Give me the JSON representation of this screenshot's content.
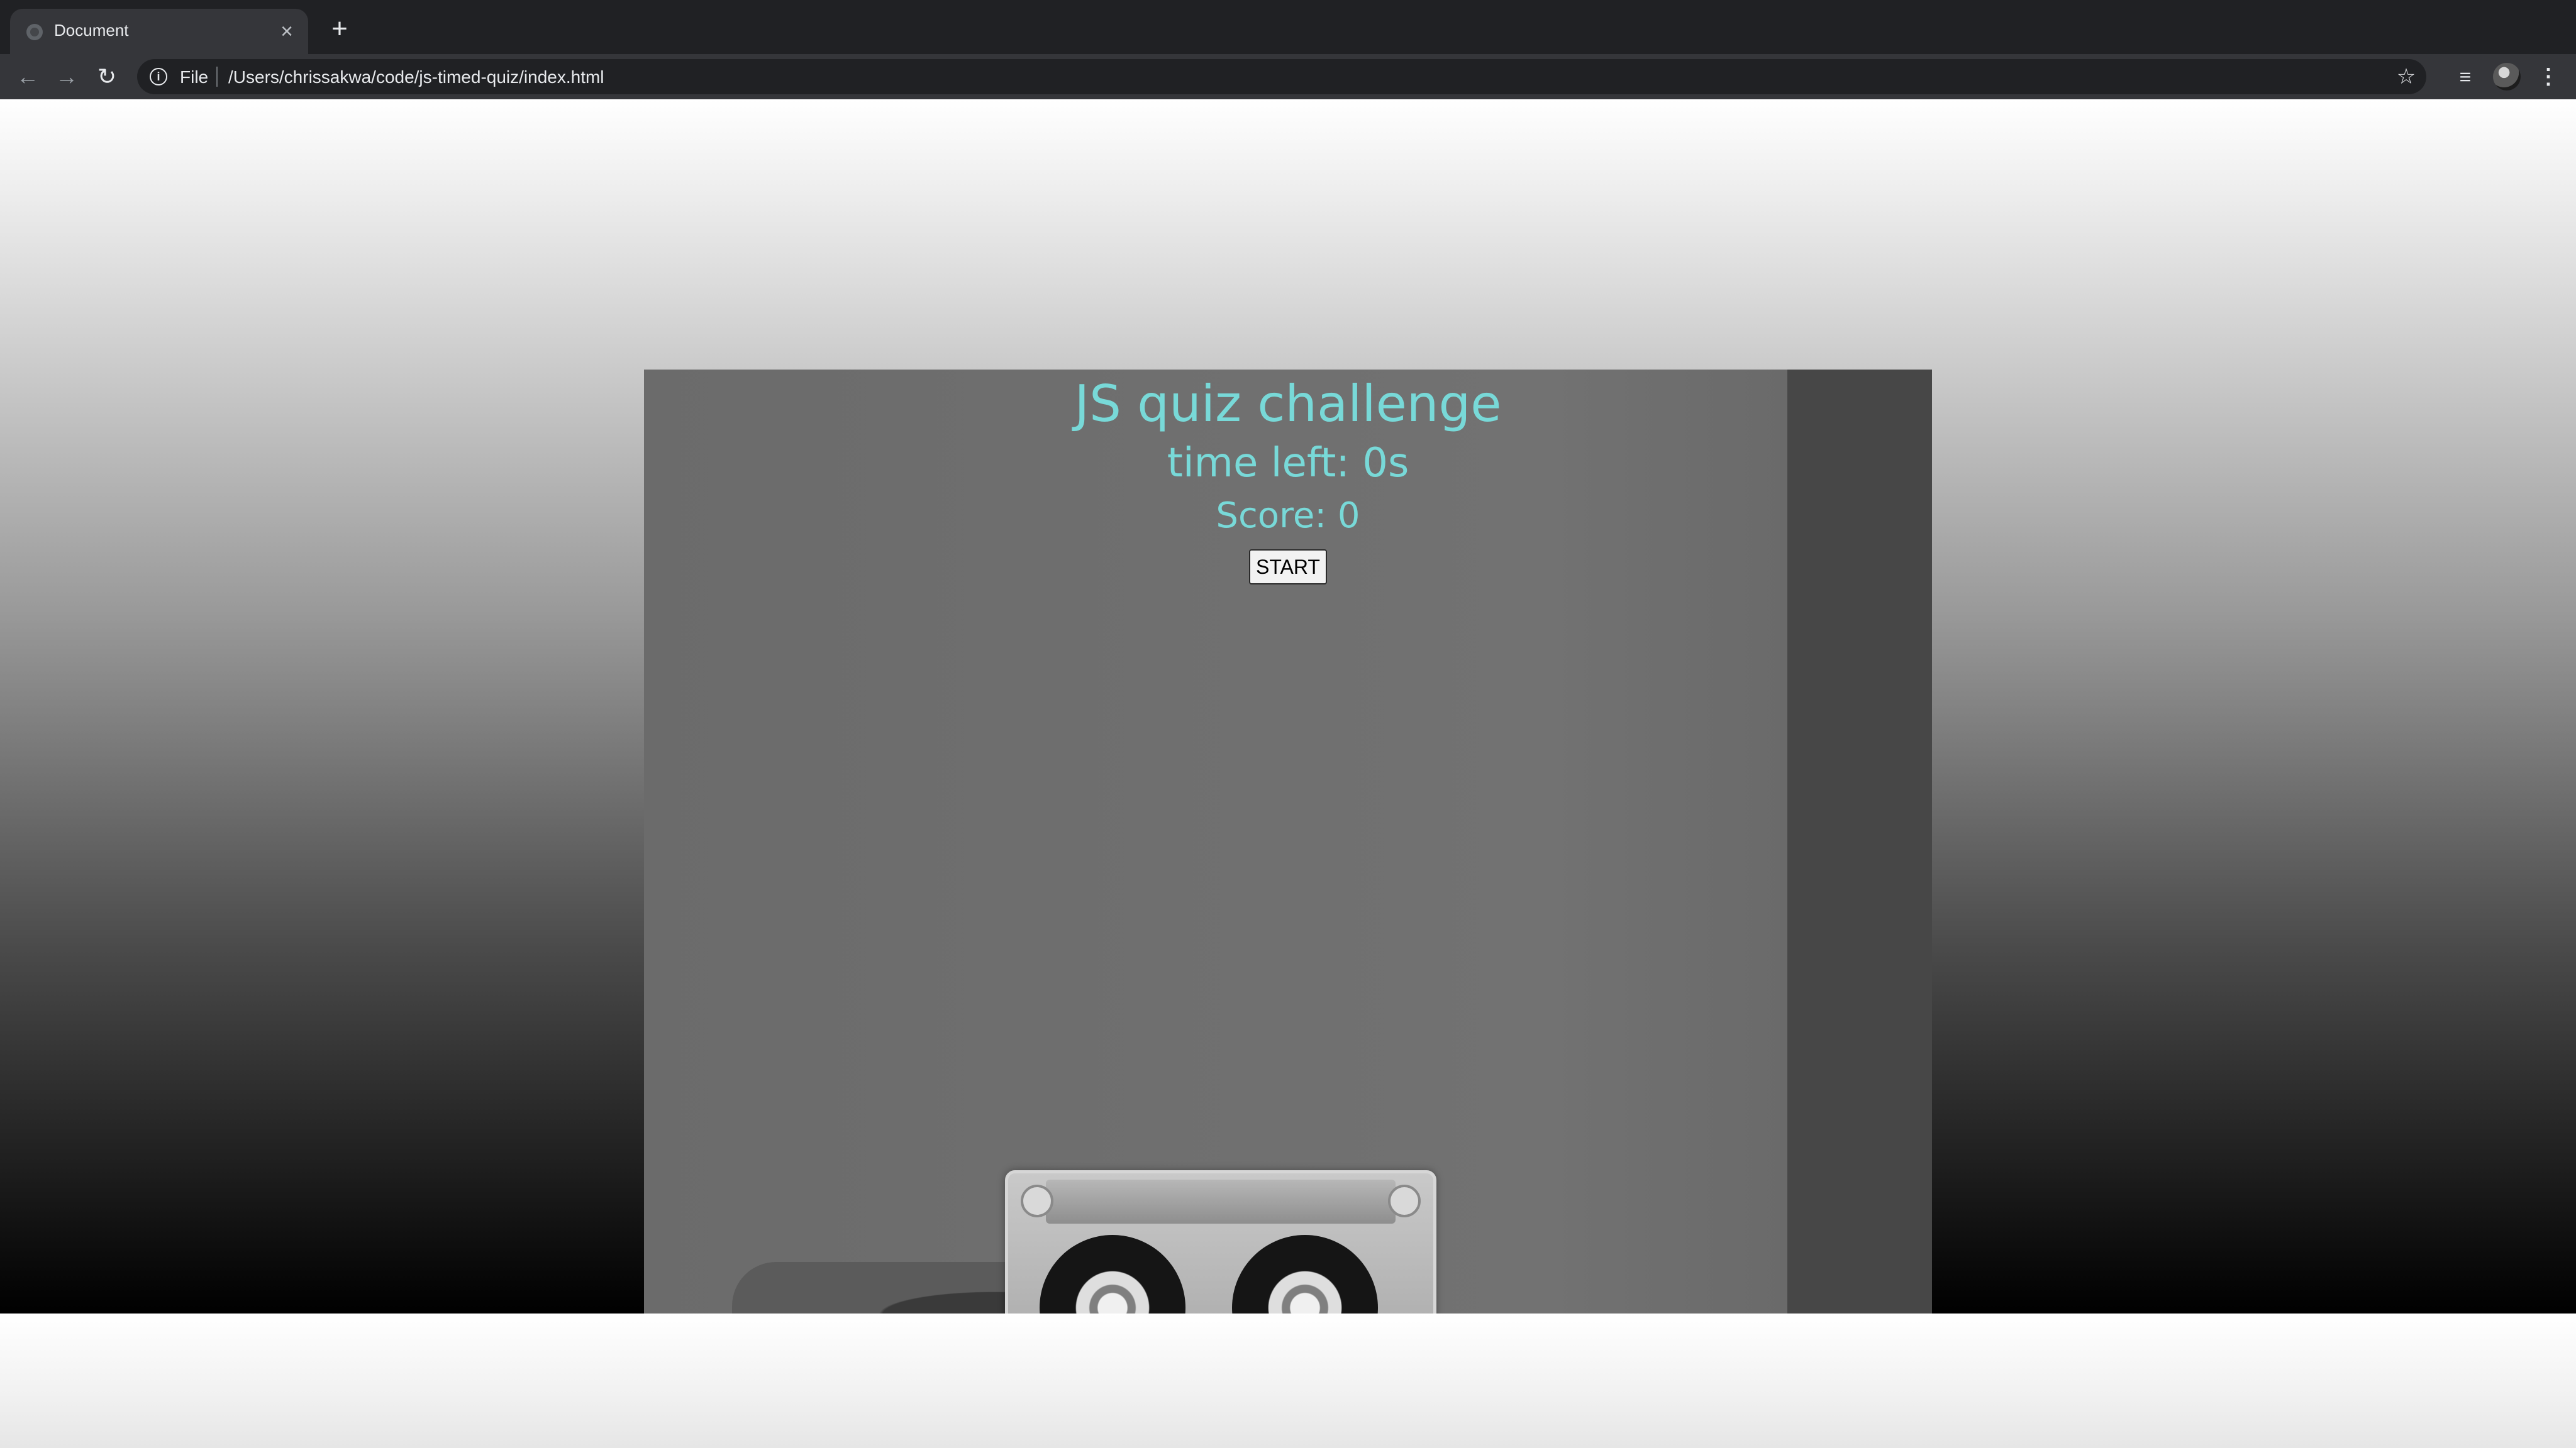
{
  "browser": {
    "tab": {
      "title": "Document",
      "close_icon": "×"
    },
    "new_tab_icon": "+",
    "toolbar": {
      "back_icon": "←",
      "forward_icon": "→",
      "reload_icon": "↻",
      "info_icon": "i",
      "scheme_label": "File",
      "url": "/Users/chrissakwa/code/js-timed-quiz/index.html",
      "star_icon": "☆",
      "media_icon": "≡",
      "menu_icon": "⋮"
    }
  },
  "quiz": {
    "title": "JS quiz challenge",
    "timer_text": "time left: 0s",
    "score_text": "Score: 0",
    "start_label": "START"
  },
  "colors": {
    "accent_text": "#78d9d8",
    "chrome_dark": "#202124",
    "chrome_toolbar": "#35363a"
  }
}
